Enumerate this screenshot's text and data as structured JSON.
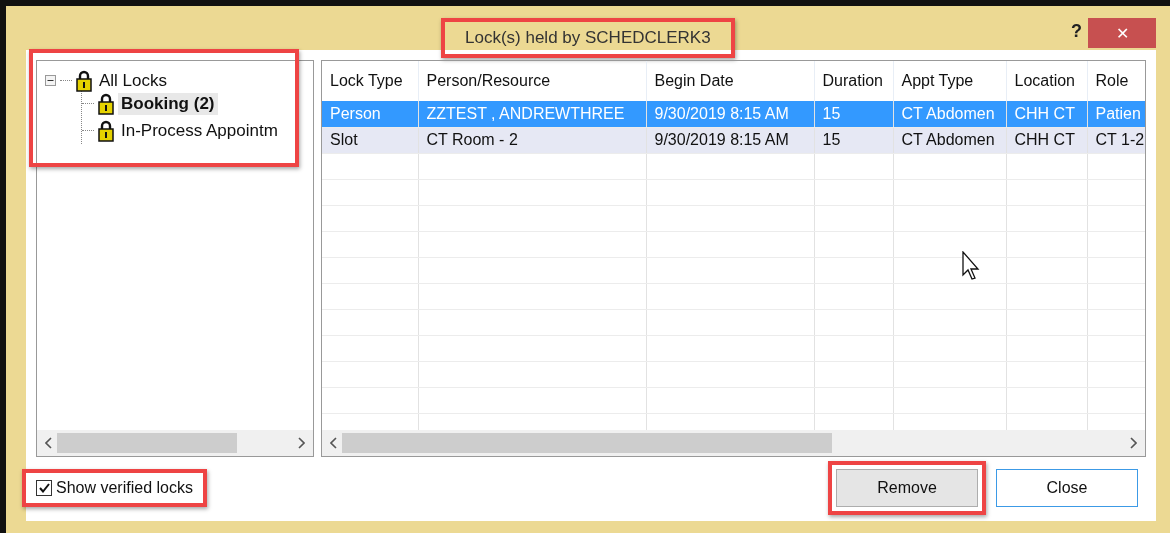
{
  "window": {
    "title": "Lock(s) held by SCHEDCLERK3",
    "title_highlighted": true,
    "help": "?",
    "close": "✕"
  },
  "tree": {
    "highlighted": true,
    "items": [
      {
        "label": "All Locks",
        "expanded": true,
        "selected": false,
        "children": [
          {
            "label": "Booking (2)",
            "selected": true
          },
          {
            "label": "In-Process Appointm",
            "selected": false
          }
        ]
      }
    ]
  },
  "table": {
    "columns": [
      "Lock Type",
      "Person/Resource",
      "Begin Date",
      "Duration",
      "Appt Type",
      "Location",
      "Role"
    ],
    "rows": [
      {
        "selected": true,
        "cells": [
          "Person",
          "ZZTEST , ANDREWTHREE",
          "9/30/2019  8:15 AM",
          "15",
          "CT Abdomen",
          "CHH CT",
          "Patien"
        ]
      },
      {
        "selected": false,
        "cells": [
          "Slot",
          "CT Room - 2",
          "9/30/2019  8:15 AM",
          "15",
          "CT Abdomen",
          "CHH CT",
          "CT 1-2"
        ]
      }
    ]
  },
  "show_verified": {
    "label": "Show verified locks",
    "checked": true,
    "highlighted": true
  },
  "buttons": [
    {
      "label": "Remove",
      "highlighted": true,
      "default": false
    },
    {
      "label": "Close",
      "highlighted": false,
      "default": true
    }
  ]
}
